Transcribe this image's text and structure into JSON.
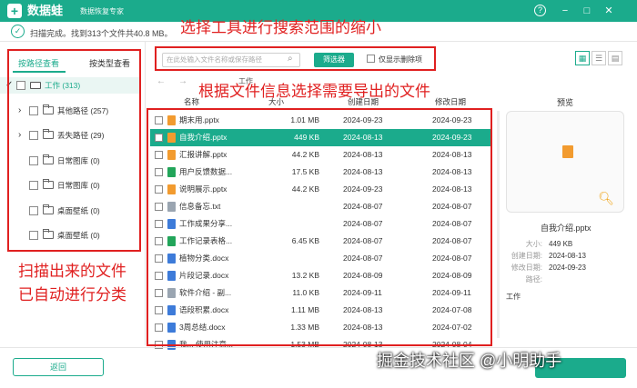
{
  "app": {
    "logo_char": "+",
    "name": "数据蛙",
    "subtitle": "数据恢复专家"
  },
  "window_controls": {
    "help": "?",
    "minimize": "−",
    "maximize": "□",
    "close": "✕"
  },
  "status": {
    "text": "扫描完成。找到313个文件共40.8 MB。",
    "check": "✓"
  },
  "left_tabs": {
    "path_view": "按路径查看",
    "type_view": "按类型查看"
  },
  "tree": [
    {
      "label": "工作 (313)",
      "level": 0,
      "icon": "drive-icon",
      "expand": "✓",
      "selected": true
    },
    {
      "label": "其他路径 (257)",
      "level": 1,
      "icon": "folder-icon",
      "expand": "›"
    },
    {
      "label": "丢失路径 (29)",
      "level": 1,
      "icon": "folder-icon",
      "expand": "›"
    },
    {
      "label": "日常图库 (0)",
      "level": 1,
      "icon": "folder-icon",
      "expand": ""
    },
    {
      "label": "日常图库 (0)",
      "level": 1,
      "icon": "folder-icon",
      "expand": ""
    },
    {
      "label": "桌面壁纸 (0)",
      "level": 1,
      "icon": "folder-icon",
      "expand": ""
    },
    {
      "label": "桌面壁纸 (0)",
      "level": 1,
      "icon": "folder-icon",
      "expand": ""
    }
  ],
  "toolbar": {
    "search_placeholder": "在此处输入文件名称或保存路径",
    "filter_label": "筛选器",
    "only_deleted_label": "仅显示删除项"
  },
  "breadcrumb": {
    "text": "工作"
  },
  "columns": {
    "name": "名称",
    "size": "大小",
    "created": "创建日期",
    "modified": "修改日期"
  },
  "files": [
    {
      "name": "期末用.pptx",
      "size": "1.01 MB",
      "created": "2024-09-23",
      "modified": "2024-09-23",
      "icon_color": "#f29b2f",
      "selected": false
    },
    {
      "name": "自我介绍.pptx",
      "size": "449 KB",
      "created": "2024-08-13",
      "modified": "2024-09-23",
      "icon_color": "#f29b2f",
      "selected": true
    },
    {
      "name": "汇报讲解.pptx",
      "size": "44.2 KB",
      "created": "2024-08-13",
      "modified": "2024-08-13",
      "icon_color": "#f29b2f",
      "selected": false
    },
    {
      "name": "用户反馈数据...",
      "size": "17.5 KB",
      "created": "2024-08-13",
      "modified": "2024-08-13",
      "icon_color": "#22a55a",
      "selected": false
    },
    {
      "name": "说明展示.pptx",
      "size": "44.2 KB",
      "created": "2024-09-23",
      "modified": "2024-08-13",
      "icon_color": "#f29b2f",
      "selected": false
    },
    {
      "name": "信息备忘.txt",
      "size": "",
      "created": "2024-08-07",
      "modified": "2024-08-07",
      "icon_color": "#9aa5b1",
      "selected": false
    },
    {
      "name": "工作成果分享...",
      "size": "",
      "created": "2024-08-07",
      "modified": "2024-08-07",
      "icon_color": "#3d7bd9",
      "selected": false
    },
    {
      "name": "工作记录表格...",
      "size": "6.45 KB",
      "created": "2024-08-07",
      "modified": "2024-08-07",
      "icon_color": "#22a55a",
      "selected": false
    },
    {
      "name": "植物分类.docx",
      "size": "",
      "created": "2024-08-07",
      "modified": "2024-08-07",
      "icon_color": "#3d7bd9",
      "selected": false
    },
    {
      "name": "片段记录.docx",
      "size": "13.2 KB",
      "created": "2024-08-09",
      "modified": "2024-08-09",
      "icon_color": "#3d7bd9",
      "selected": false
    },
    {
      "name": "软件介绍 - 副...",
      "size": "11.0 KB",
      "created": "2024-09-11",
      "modified": "2024-09-11",
      "icon_color": "#9aa5b1",
      "selected": false
    },
    {
      "name": "语段积累.docx",
      "size": "1.11 MB",
      "created": "2024-08-13",
      "modified": "2024-07-08",
      "icon_color": "#3d7bd9",
      "selected": false
    },
    {
      "name": "3周总结.docx",
      "size": "1.33 MB",
      "created": "2024-08-13",
      "modified": "2024-07-02",
      "icon_color": "#3d7bd9",
      "selected": false
    },
    {
      "name": "我... 使用注意...",
      "size": "1.53 MB",
      "created": "2024-08-13",
      "modified": "2024-08-04",
      "icon_color": "#3d7bd9",
      "selected": false
    }
  ],
  "preview": {
    "title": "预览",
    "filename": "自我介绍.pptx",
    "meta": [
      {
        "key": "大小:",
        "value": "449 KB"
      },
      {
        "key": "创建日期:",
        "value": "2024-08-13"
      },
      {
        "key": "修改日期:",
        "value": "2024-09-23"
      },
      {
        "key": "路径:",
        "value": ""
      }
    ],
    "path_value": "工作"
  },
  "buttons": {
    "back": "返回"
  },
  "annotations": {
    "toolbar_note": "选择工具进行搜索范围的缩小",
    "list_note": "根据文件信息选择需要导出的文件",
    "left_note_line1": "扫描出来的文件",
    "left_note_line2": "已自动进行分类"
  },
  "watermark": "掘金技术社区 @小明助手",
  "colors": {
    "accent": "#1bab8c",
    "annotation": "#e02020"
  }
}
